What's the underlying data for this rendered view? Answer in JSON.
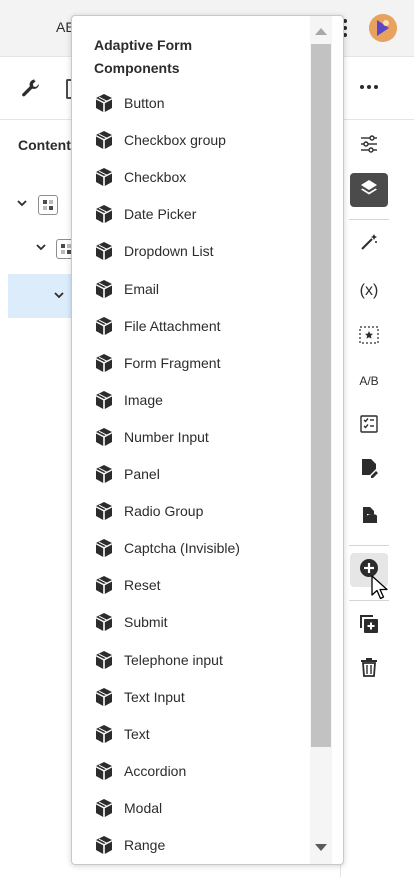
{
  "app": {
    "title": "AE"
  },
  "left_panel": {
    "tab_label": "Content"
  },
  "popover": {
    "heading": "Adaptive Form Components",
    "items": [
      "Button",
      "Checkbox group",
      "Checkbox",
      "Date Picker",
      "Dropdown List",
      "Email",
      "File Attachment",
      "Form Fragment",
      "Image",
      "Number Input",
      "Panel",
      "Radio Group",
      "Captcha (Invisible)",
      "Reset",
      "Submit",
      "Telephone input",
      "Text Input",
      "Text",
      "Accordion",
      "Modal",
      "Range"
    ]
  },
  "rail": {
    "variables_label": "(x)",
    "ab_label": "A/B"
  },
  "colors": {
    "active_rail": "#4b4b4b",
    "selected_row": "#dcecfb"
  }
}
